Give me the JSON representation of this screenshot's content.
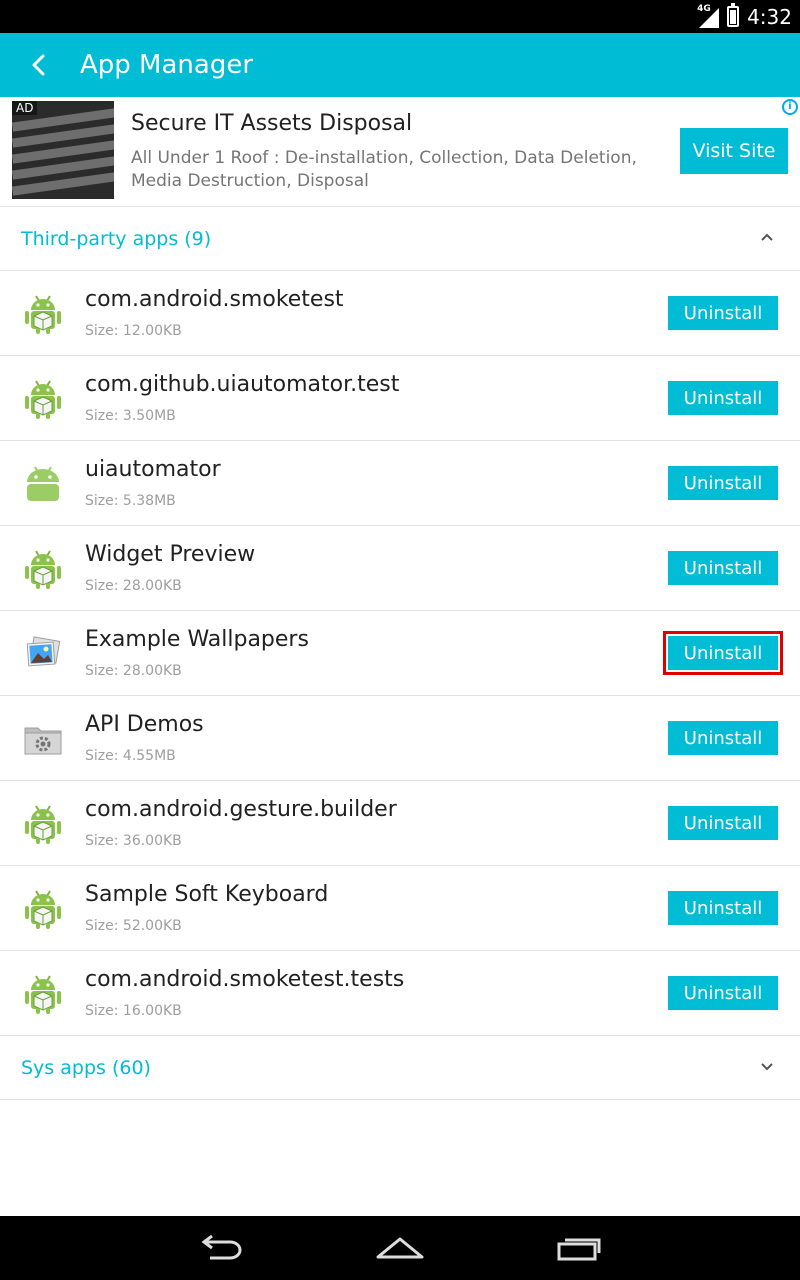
{
  "status_bar": {
    "network": "4G",
    "time": "4:32"
  },
  "app_bar": {
    "title": "App Manager",
    "back_icon": "back-arrow-icon"
  },
  "ad": {
    "badge": "AD",
    "title": "Secure IT Assets Disposal",
    "description": "All Under 1 Roof : De-installation, Collection, Data Deletion, Media Destruction, Disposal",
    "button_label": "Visit Site",
    "info_icon": "i"
  },
  "sections": {
    "third_party": {
      "label": "Third-party apps (9)",
      "expanded": true
    },
    "sys": {
      "label": "Sys apps (60)",
      "expanded": false
    }
  },
  "apps": [
    {
      "name": "com.android.smoketest",
      "size": "Size: 12.00KB",
      "icon": "android-package-icon",
      "button": "Uninstall"
    },
    {
      "name": "com.github.uiautomator.test",
      "size": "Size: 3.50MB",
      "icon": "android-package-icon",
      "button": "Uninstall"
    },
    {
      "name": "uiautomator",
      "size": "Size: 5.38MB",
      "icon": "android-robot-icon",
      "button": "Uninstall"
    },
    {
      "name": "Widget Preview",
      "size": "Size: 28.00KB",
      "icon": "android-package-icon",
      "button": "Uninstall"
    },
    {
      "name": "Example Wallpapers",
      "size": "Size: 28.00KB",
      "icon": "wallpapers-icon",
      "button": "Uninstall",
      "highlighted": true
    },
    {
      "name": "API Demos",
      "size": "Size: 4.55MB",
      "icon": "settings-folder-icon",
      "button": "Uninstall"
    },
    {
      "name": "com.android.gesture.builder",
      "size": "Size: 36.00KB",
      "icon": "android-package-icon",
      "button": "Uninstall"
    },
    {
      "name": "Sample Soft Keyboard",
      "size": "Size: 52.00KB",
      "icon": "android-package-icon",
      "button": "Uninstall"
    },
    {
      "name": "com.android.smoketest.tests",
      "size": "Size: 16.00KB",
      "icon": "android-package-icon",
      "button": "Uninstall"
    }
  ],
  "colors": {
    "accent": "#00bcd4",
    "highlight": "#e00000"
  },
  "nav_bar": {
    "back": "nav-back-icon",
    "home": "nav-home-icon",
    "recents": "nav-recents-icon"
  }
}
